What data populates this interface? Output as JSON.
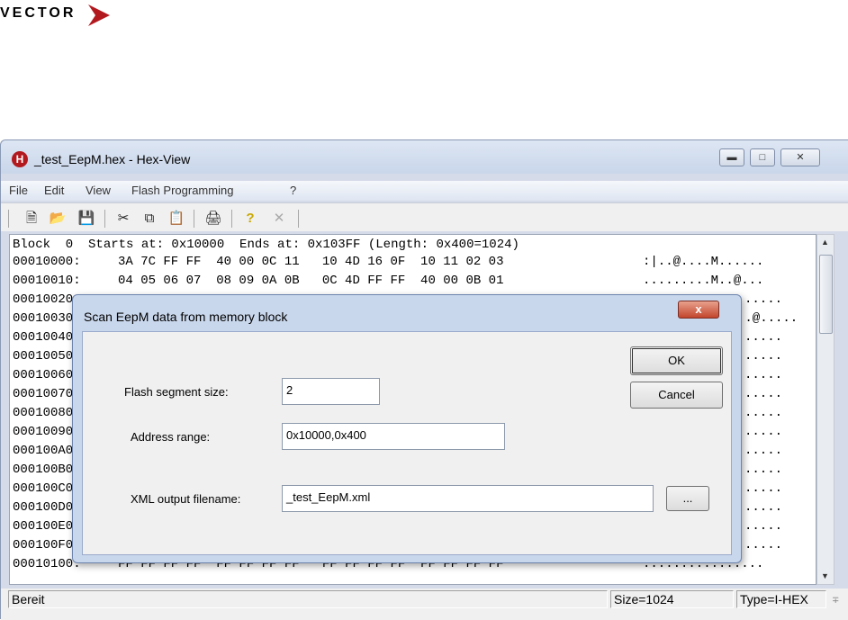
{
  "logo": {
    "text": "VECTOR"
  },
  "window": {
    "title": "_test_EepM.hex - Hex-View",
    "app_icon": "H",
    "caption_icons": [
      "minimize-icon",
      "maximize-icon",
      "close-icon"
    ]
  },
  "menu": [
    "File",
    "Edit",
    "View",
    "Flash Programming",
    "?"
  ],
  "toolbar": {
    "icons": [
      "new-file-icon",
      "open-folder-icon",
      "save-icon",
      "cut-icon",
      "copy-icon",
      "paste-icon",
      "print-icon",
      "help-icon",
      "delete-icon"
    ]
  },
  "hex": {
    "block_header": "Block  0  Starts at: 0x10000  Ends at: 0x103FF (Length: 0x400=1024)",
    "rows": [
      {
        "addr": "00010000:",
        "bytes": "3A 7C FF FF  40 00 0C 11   10 4D 16 0F  10 11 02 03",
        "ascii": ":|..@....M......"
      },
      {
        "addr": "00010010:",
        "bytes": "04 05 06 07  08 09 0A 0B   0C 4D FF FF  40 00 0B 01",
        "ascii": ".........M..@..."
      },
      {
        "addr": "00010020",
        "bytes": "",
        "ascii": "....."
      },
      {
        "addr": "00010030",
        "bytes": "",
        "ascii": "..@....."
      },
      {
        "addr": "00010040",
        "bytes": "",
        "ascii": "....."
      },
      {
        "addr": "00010050",
        "bytes": "",
        "ascii": "....."
      },
      {
        "addr": "00010060",
        "bytes": "",
        "ascii": "....."
      },
      {
        "addr": "00010070",
        "bytes": "",
        "ascii": "....."
      },
      {
        "addr": "00010080",
        "bytes": "",
        "ascii": "....."
      },
      {
        "addr": "00010090",
        "bytes": "",
        "ascii": "....."
      },
      {
        "addr": "000100A0",
        "bytes": "",
        "ascii": "....."
      },
      {
        "addr": "000100B0",
        "bytes": "",
        "ascii": "....."
      },
      {
        "addr": "000100C0",
        "bytes": "",
        "ascii": "....."
      },
      {
        "addr": "000100D0",
        "bytes": "",
        "ascii": "....."
      },
      {
        "addr": "000100E0",
        "bytes": "",
        "ascii": "....."
      },
      {
        "addr": "000100F0",
        "bytes": "",
        "ascii": "....."
      },
      {
        "addr": "00010100:",
        "bytes": "FF FF FF FF  FF FF FF FF   FF FF FF FF  FF FF FF FF",
        "ascii": "................"
      }
    ]
  },
  "status": {
    "text": "Bereit",
    "size": "Size=1024",
    "type": "Type=I-HEX"
  },
  "dialog": {
    "title": "Scan EepM data from memory block",
    "close_label": "x",
    "ok_label": "OK",
    "cancel_label": "Cancel",
    "segment_label": "Flash segment size:",
    "segment_value": "2",
    "range_label": "Address range:",
    "range_value": "0x10000,0x400",
    "xml_label": "XML output filename:",
    "xml_value": "_test_EepM.xml",
    "browse_label": "..."
  }
}
